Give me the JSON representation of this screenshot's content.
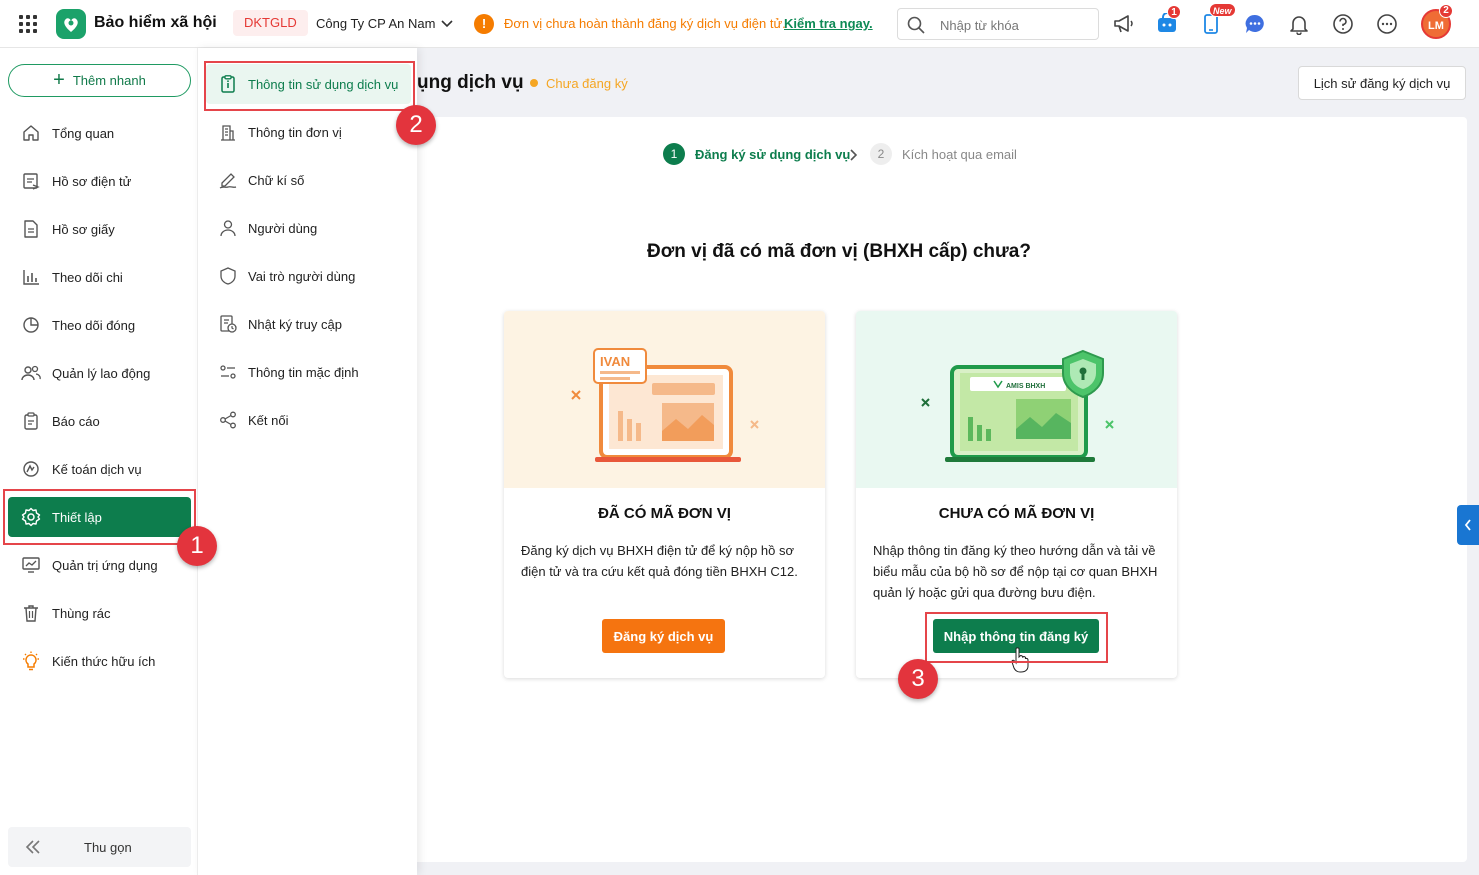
{
  "app": {
    "title": "Bảo hiểm xã hội",
    "org_code": "DKTGLD",
    "company": "Công Ty CP An Nam",
    "alert_text": "Đơn vị chưa hoàn thành đăng ký dịch vụ điện tử.",
    "alert_link": "Kiểm tra ngay.",
    "search_placeholder": "Nhập từ khóa",
    "cart_badge": "1",
    "phone_badge": "New",
    "avatar_initials": "LM",
    "avatar_badge": "2"
  },
  "sidebar": {
    "quick_add": "Thêm nhanh",
    "items": [
      {
        "label": "Tổng quan",
        "icon": "home-icon"
      },
      {
        "label": "Hồ sơ điện tử",
        "icon": "e-document-icon"
      },
      {
        "label": "Hồ sơ giấy",
        "icon": "paper-document-icon"
      },
      {
        "label": "Theo dõi chi",
        "icon": "bar-chart-icon"
      },
      {
        "label": "Theo dõi đóng",
        "icon": "pie-chart-icon"
      },
      {
        "label": "Quản lý lao động",
        "icon": "users-icon"
      },
      {
        "label": "Báo cáo",
        "icon": "clipboard-icon"
      },
      {
        "label": "Kế toán dịch vụ",
        "icon": "accounting-icon"
      },
      {
        "label": "Thiết lập",
        "icon": "gear-icon"
      },
      {
        "label": "Quản trị ứng dụng",
        "icon": "monitor-chart-icon"
      },
      {
        "label": "Thùng rác",
        "icon": "trash-icon"
      },
      {
        "label": "Kiến thức hữu ích",
        "icon": "lightbulb-icon"
      }
    ],
    "collapse": "Thu gọn"
  },
  "submenu": {
    "items": [
      {
        "label": "Thông tin sử dụng dịch vụ",
        "icon": "service-info-icon"
      },
      {
        "label": "Thông tin đơn vị",
        "icon": "building-icon"
      },
      {
        "label": "Chữ kí số",
        "icon": "signature-icon"
      },
      {
        "label": "Người dùng",
        "icon": "user-icon"
      },
      {
        "label": "Vai trò người dùng",
        "icon": "shield-icon"
      },
      {
        "label": "Nhật ký truy cập",
        "icon": "access-log-icon"
      },
      {
        "label": "Thông tin mặc định",
        "icon": "settings-list-icon"
      },
      {
        "label": "Kết nối",
        "icon": "share-icon"
      }
    ]
  },
  "main": {
    "title": "ụng dịch vụ",
    "status": "Chưa đăng ký",
    "history_button": "Lịch sử đăng ký dịch vụ",
    "steps": [
      {
        "num": "1",
        "label": "Đăng ký sử dụng dịch vụ"
      },
      {
        "num": "2",
        "label": "Kích hoạt qua email"
      }
    ],
    "question": "Đơn vị đã có mã đơn vị (BHXH cấp) chưa?",
    "options": [
      {
        "illus_label": "IVAN",
        "title": "ĐÃ CÓ MÃ ĐƠN VỊ",
        "text": "Đăng ký dịch vụ BHXH điện tử để ký nộp hồ sơ điện tử và tra cứu kết quả đóng tiền BHXH C12.",
        "button": "Đăng ký dịch vụ"
      },
      {
        "illus_label": "AMIS BHXH",
        "title": "CHƯA CÓ MÃ ĐƠN VỊ",
        "text": "Nhập thông tin đăng ký theo hướng dẫn và tải về biểu mẫu của bộ hồ sơ để nộp tại cơ quan BHXH quản lý hoặc gửi qua đường bưu điện.",
        "button": "Nhập thông tin đăng ký"
      }
    ]
  },
  "annotations": [
    "1",
    "2",
    "3"
  ],
  "colors": {
    "brand_green": "#0d7d4d",
    "accent_orange": "#f57c00",
    "annotation_red": "#e3343d"
  }
}
